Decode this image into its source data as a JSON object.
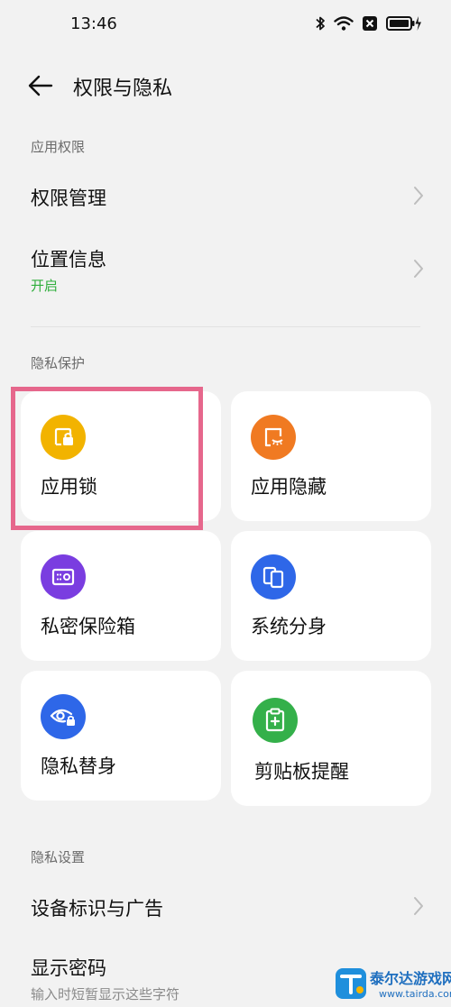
{
  "status_bar": {
    "time": "13:46",
    "icons": [
      "bluetooth-icon",
      "wifi-icon",
      "sim-off-icon",
      "battery-charging-icon"
    ]
  },
  "header": {
    "title": "权限与隐私",
    "back_icon": "arrow-left-icon"
  },
  "sections": {
    "app_permissions": {
      "label": "应用权限",
      "items": [
        {
          "title": "权限管理"
        },
        {
          "title": "位置信息",
          "subtitle": "开启"
        }
      ]
    },
    "privacy_protection": {
      "label": "隐私保护",
      "cards": [
        {
          "label": "应用锁",
          "icon": "app-lock-icon",
          "color": "#f2b300"
        },
        {
          "label": "应用隐藏",
          "icon": "app-hide-icon",
          "color": "#f07a22"
        },
        {
          "label": "私密保险箱",
          "icon": "private-safe-icon",
          "color": "#7a3de0"
        },
        {
          "label": "系统分身",
          "icon": "system-clone-icon",
          "color": "#2e67e8"
        },
        {
          "label": "隐私替身",
          "icon": "privacy-double-icon",
          "color": "#2e67e8"
        },
        {
          "label": "剪贴板提醒",
          "icon": "clipboard-reminder-icon",
          "color": "#34b04a"
        }
      ]
    },
    "privacy_settings": {
      "label": "隐私设置",
      "items": [
        {
          "title": "设备标识与广告"
        },
        {
          "title": "显示密码",
          "subtitle": "输入时短暂显示这些字符"
        }
      ]
    }
  },
  "colors": {
    "accent_green": "#2fae3c",
    "highlight": "#e6678c"
  },
  "watermark": {
    "name": "泰尔达游戏网",
    "url": "www.tairda.com"
  }
}
